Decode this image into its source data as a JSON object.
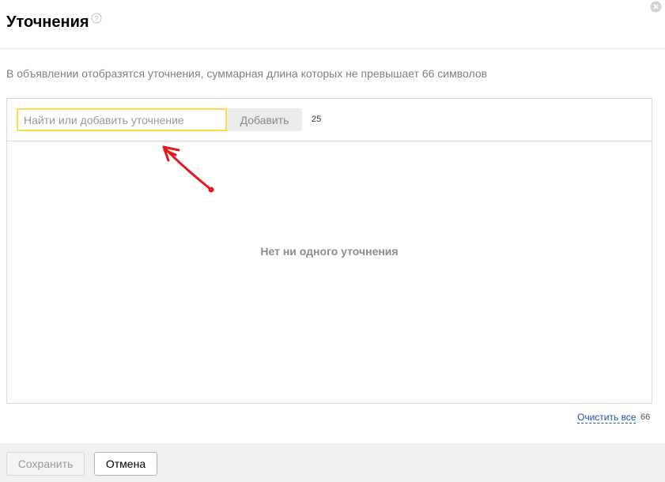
{
  "dialog": {
    "title": "Уточнения",
    "help_icon": "question-circle-icon",
    "close_icon": "close-circle-icon"
  },
  "description": "В объявлении отобразятся уточнения, суммарная длина которых не превышает 66 символов",
  "toolbar": {
    "search_placeholder": "Найти или добавить уточнение",
    "search_value": "",
    "add_label": "Добавить",
    "char_counter": "25"
  },
  "list": {
    "empty_message": "Нет ни одного уточнения",
    "items": []
  },
  "summary": {
    "clear_all_label": "Очистить все",
    "length_limit": "66"
  },
  "footer": {
    "save_label": "Сохранить",
    "cancel_label": "Отмена"
  },
  "annotation": {
    "arrow_icon": "red-arrow-annotation",
    "color": "#e8161b"
  },
  "colors": {
    "focus_border": "#ffdb4d",
    "link": "#1a55a6",
    "footer_bg": "#f0f0f0"
  }
}
